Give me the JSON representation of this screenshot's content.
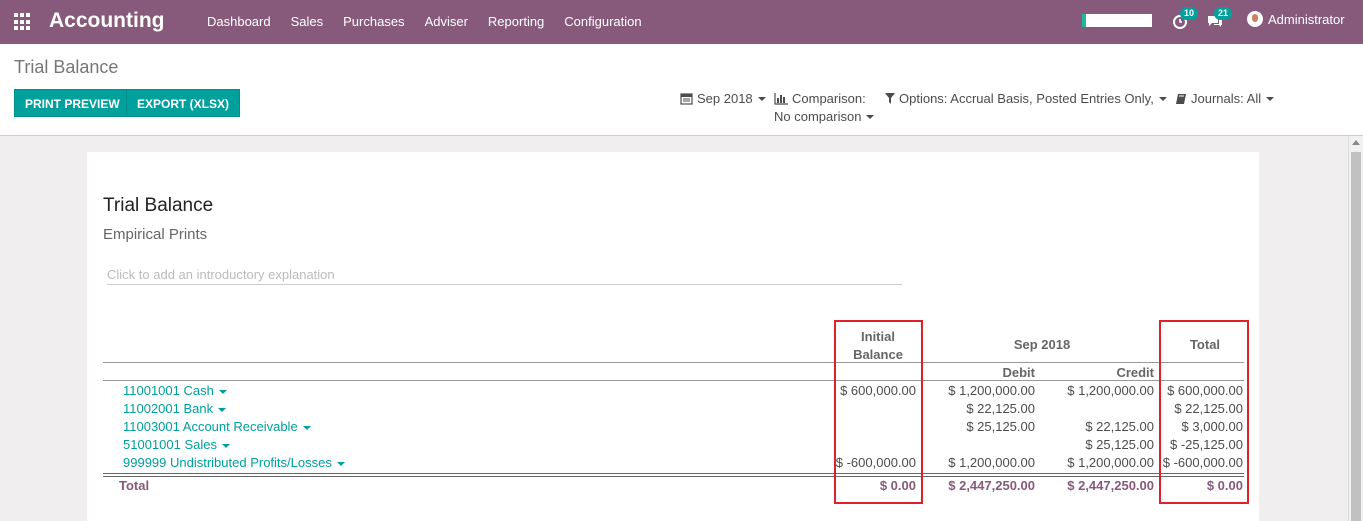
{
  "topbar": {
    "app_title": "Accounting",
    "menu": [
      "Dashboard",
      "Sales",
      "Purchases",
      "Adviser",
      "Reporting",
      "Configuration"
    ],
    "activity_count": "10",
    "messages_count": "21",
    "user_name": "Administrator"
  },
  "control_panel": {
    "breadcrumb": "Trial Balance",
    "print_preview": "PRINT PREVIEW",
    "export_xlsx": "EXPORT (XLSX)",
    "date_filter": "Sep 2018",
    "comparison_label": "Comparison:",
    "comparison_value": "No comparison",
    "options_filter": "Options: Accrual Basis, Posted Entries Only,",
    "journals_filter": "Journals: All"
  },
  "report": {
    "title": "Trial Balance",
    "company": "Empirical Prints",
    "intro_placeholder": "Click to add an introductory explanation",
    "headers": {
      "initial_balance_1": "Initial",
      "initial_balance_2": "Balance",
      "period": "Sep 2018",
      "debit": "Debit",
      "credit": "Credit",
      "total": "Total"
    },
    "rows": [
      {
        "account": "11001001 Cash",
        "initial": "$ 600,000.00",
        "debit": "$ 1,200,000.00",
        "credit": "$ 1,200,000.00",
        "total": "$ 600,000.00"
      },
      {
        "account": "11002001 Bank",
        "initial": "",
        "debit": "$ 22,125.00",
        "credit": "",
        "total": "$ 22,125.00"
      },
      {
        "account": "11003001 Account Receivable",
        "initial": "",
        "debit": "$ 25,125.00",
        "credit": "$ 22,125.00",
        "total": "$ 3,000.00"
      },
      {
        "account": "51001001 Sales",
        "initial": "",
        "debit": "",
        "credit": "$ 25,125.00",
        "total": "$ -25,125.00"
      },
      {
        "account": "999999 Undistributed Profits/Losses",
        "initial": "$ -600,000.00",
        "debit": "$ 1,200,000.00",
        "credit": "$ 1,200,000.00",
        "total": "$ -600,000.00"
      }
    ],
    "total_row": {
      "label": "Total",
      "initial": "$ 0.00",
      "debit": "$ 2,447,250.00",
      "credit": "$ 2,447,250.00",
      "total": "$ 0.00"
    }
  },
  "colors": {
    "brand": "#875a7b",
    "primary_button": "#00a09d",
    "highlight_box": "#e0202a"
  }
}
